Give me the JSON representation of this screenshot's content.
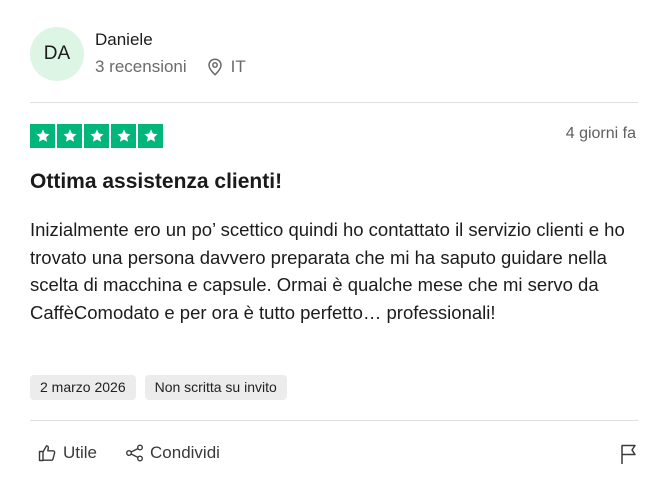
{
  "reviewer": {
    "initials": "DA",
    "name": "Daniele",
    "reviews_count": "3 recensioni",
    "country": "IT"
  },
  "review": {
    "rating": 5,
    "relative_date": "4 giorni fa",
    "title": "Ottima assistenza clienti!",
    "body": "Inizialmente ero un po’ scettico quindi ho contattato il servizio clienti e ho trovato una persona davvero preparata che mi ha saputo guidare nella scelta di macchina e capsule. Ormai è qualche mese che mi servo da CaffèComodato e per ora è tutto perfetto… professionali!",
    "date": "2 marzo 2026",
    "invite_label": "Non scritta su invito"
  },
  "actions": {
    "useful": "Utile",
    "share": "Condividi"
  },
  "colors": {
    "star_green": "#00b67a",
    "avatar_bg": "#dcf5e4"
  },
  "icons": [
    "location-pin-icon",
    "star-icon",
    "thumbs-up-icon",
    "share-icon",
    "flag-icon"
  ]
}
